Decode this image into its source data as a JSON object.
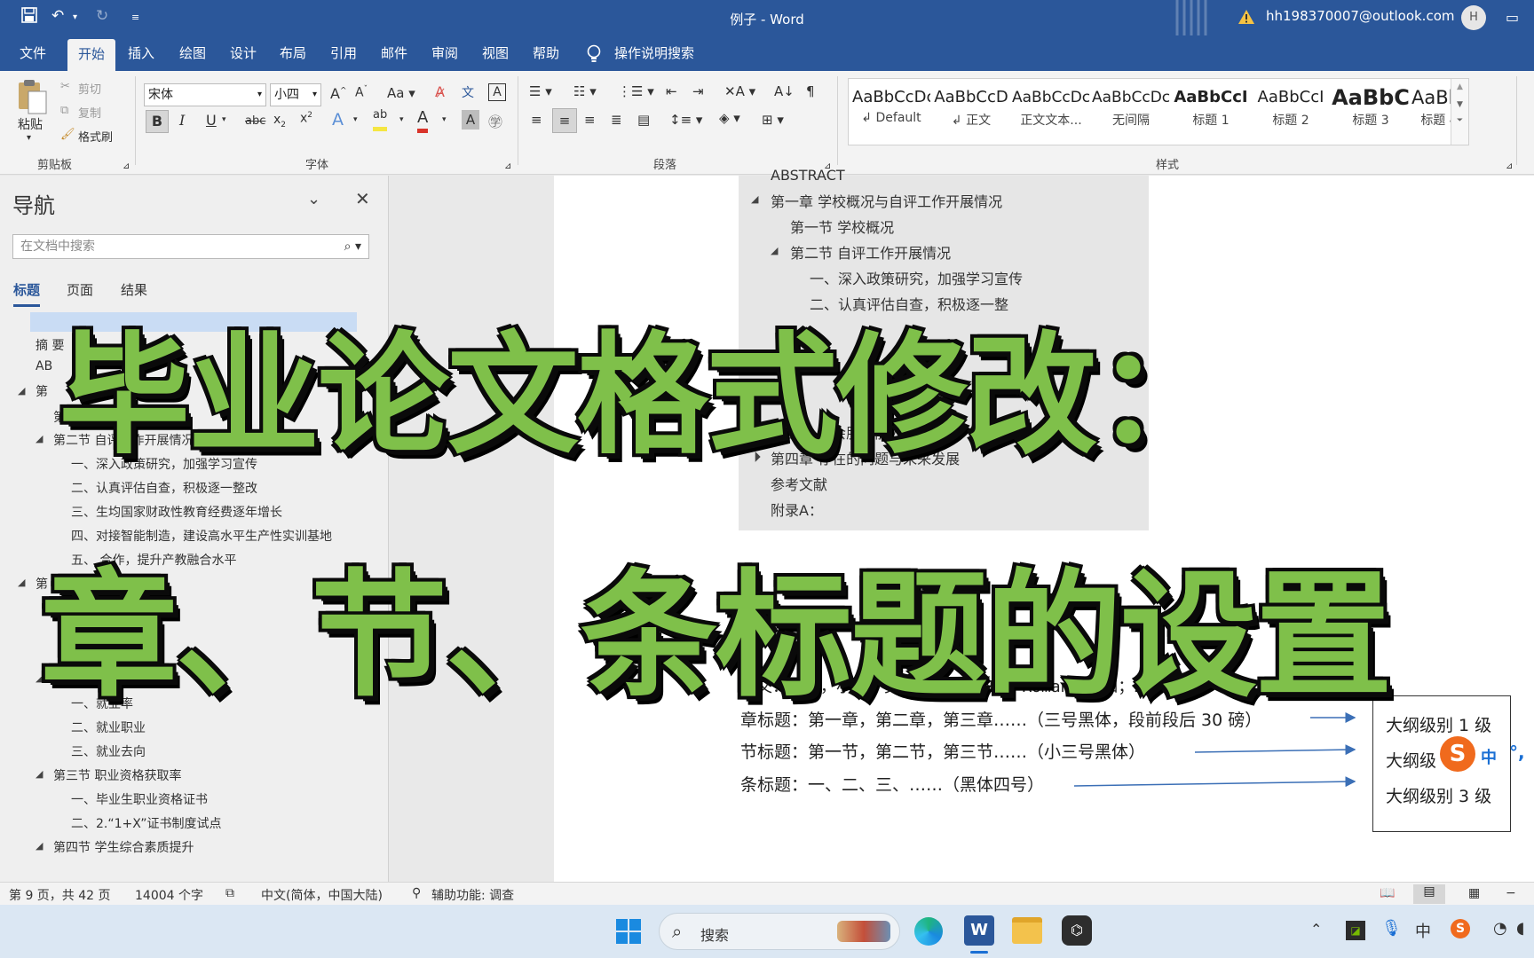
{
  "window": {
    "title": "例子  -  Word",
    "account": "hh198370007@outlook.com",
    "avatar_initial": "H"
  },
  "menu": {
    "tabs": [
      {
        "label": "文件"
      },
      {
        "label": "开始"
      },
      {
        "label": "插入"
      },
      {
        "label": "绘图"
      },
      {
        "label": "设计"
      },
      {
        "label": "布局"
      },
      {
        "label": "引用"
      },
      {
        "label": "邮件"
      },
      {
        "label": "审阅"
      },
      {
        "label": "视图"
      },
      {
        "label": "帮助"
      }
    ],
    "active_tab": "开始",
    "tell_me": "操作说明搜索"
  },
  "ribbon": {
    "clipboard": {
      "paste": "粘贴",
      "cut": "剪切",
      "copy": "复制",
      "format_painter": "格式刷",
      "group": "剪贴板"
    },
    "font": {
      "name": "宋体",
      "size": "小四",
      "group": "字体"
    },
    "paragraph": {
      "group": "段落"
    },
    "styles": {
      "group": "样式",
      "items": [
        {
          "sample": "AaBbCcDc",
          "name": "↲ Default"
        },
        {
          "sample": "AaBbCcD",
          "name": "↲ 正文"
        },
        {
          "sample": "AaBbCcDc",
          "name": "正文文本..."
        },
        {
          "sample": "AaBbCcDc",
          "name": "无间隔"
        },
        {
          "sample": "AaBbCcI",
          "name": "标题 1"
        },
        {
          "sample": "AaBbCcI",
          "name": "标题 2"
        },
        {
          "sample": "AaBbC",
          "name": "标题 3"
        },
        {
          "sample": "AaBbCc",
          "name": "标题 4"
        }
      ]
    }
  },
  "nav": {
    "title": "导航",
    "search_placeholder": "在文档中搜索",
    "tabs": [
      "标题",
      "页面",
      "结果"
    ],
    "items": [
      {
        "text": "摘 要"
      },
      {
        "text": "AB"
      },
      {
        "text": "第"
      },
      {
        "text": "第一节 学"
      },
      {
        "text": "第二节 自评工作开展情况"
      },
      {
        "text": "一、深入政策研究，加强学习宣传"
      },
      {
        "text": "二、认真评估自查，积极逐一整改"
      },
      {
        "text": "三、生均国家财政性教育经费逐年增长"
      },
      {
        "text": "四、对接智能制造，建设高水平生产性实训基地"
      },
      {
        "text": "五、   合作，提升产教融合水平"
      },
      {
        "text": "第"
      },
      {
        "text": "第二节 毕   就业质量"
      },
      {
        "text": "一、就业率"
      },
      {
        "text": "二、就业职业"
      },
      {
        "text": "三、就业去向"
      },
      {
        "text": "第三节 职业资格获取率"
      },
      {
        "text": "一、毕业生职业资格证书"
      },
      {
        "text": "二、2.“1+X”证书制度试点"
      },
      {
        "text": "第四节 学生综合素质提升"
      }
    ]
  },
  "document": {
    "toc_top": "ABSTRACT",
    "toc": [
      {
        "text": "第一章 学校概况与自评工作开展情况"
      },
      {
        "text": "第一节 学校概况"
      },
      {
        "text": "第二节 自评工作开展情况"
      },
      {
        "text": "一、深入政策研究，加强学习宣传"
      },
      {
        "text": "二、认真评估自查，积极逐一整"
      },
      {
        "text": "造"
      },
      {
        "text": "作"
      },
      {
        "text": "展"
      },
      {
        "text": "第三章 社会服务能力"
      },
      {
        "text": "第四章 存在的问题与未来发展"
      },
      {
        "text": "参考文献"
      },
      {
        "text": "附录A："
      }
    ],
    "body_line": "正文：宋体，小四；英文 Times New Roman，小四；20 磅。",
    "rules": [
      {
        "text": "章标题：第一章，第二章，第三章……（三号黑体，段前段后 30 磅）"
      },
      {
        "text": "节标题：第一节，第二节，第三节……（小三号黑体）"
      },
      {
        "text": "条标题：一、二、三、……（黑体四号）"
      }
    ],
    "outline_levels": [
      "大纲级别 1 级",
      "大纲级",
      "大纲级别 3 级"
    ],
    "ime_label": "中"
  },
  "overlay": {
    "line1": "毕业论文格式修改：",
    "line2": "章、节、条标题的设置"
  },
  "status": {
    "page": "第 9 页，共 42 页",
    "words": "14004 个字",
    "language": "中文(简体，中国大陆)",
    "accessibility": "辅助功能: 调查"
  },
  "taskbar": {
    "search": "搜索"
  },
  "colors": {
    "word_blue": "#2b579a",
    "overlay_green": "#7fc04a",
    "arrow_blue": "#3b6fb6"
  }
}
